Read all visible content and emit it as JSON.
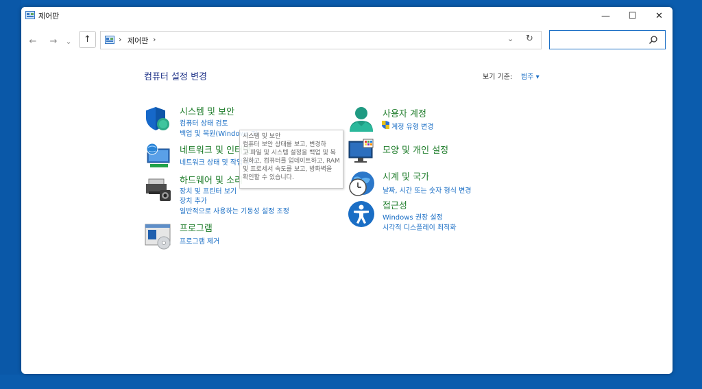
{
  "window": {
    "title": "제어판",
    "minimize": "—",
    "maximize": "☐",
    "close": "✕"
  },
  "nav": {
    "back": "←",
    "forward": "→",
    "recent": "⌄",
    "up": "↑"
  },
  "address": {
    "sep1": "›",
    "crumb": "제어판",
    "sep2": "›",
    "dropdown": "⌄",
    "refresh": "↻"
  },
  "search": {
    "placeholder": ""
  },
  "header": {
    "heading": "컴퓨터 설정 변경",
    "view_by_label": "보기 기준:",
    "view_by_value": "범주 ▾"
  },
  "categories": {
    "system": {
      "title": "시스템 및 보안",
      "links": [
        "컴퓨터 상태 검토",
        "백업 및 복원(Windows 7)"
      ]
    },
    "network": {
      "title": "네트워크 및 인터넷",
      "links": [
        "네트워크 상태 및 작업 보기"
      ]
    },
    "hardware": {
      "title": "하드웨어 및 소리",
      "links": [
        "장치 및 프린터 보기",
        "장치 추가",
        "일반적으로 사용하는 기동성 설정 조정"
      ]
    },
    "programs": {
      "title": "프로그램",
      "links": [
        "프로그램 제거"
      ]
    },
    "users": {
      "title": "사용자 계정",
      "links": [
        "계정 유형 변경"
      ]
    },
    "appearance": {
      "title": "모양 및 개인 설정",
      "links": []
    },
    "clock": {
      "title": "시계 및 국가",
      "links": [
        "날짜, 시간 또는 숫자 형식 변경"
      ]
    },
    "access": {
      "title": "접근성",
      "links": [
        "Windows 권장 설정",
        "시각적 디스플레이 최적화"
      ]
    }
  },
  "tooltip": {
    "lines": [
      "시스템 및 보안",
      "컴퓨터 보안 상태를 보고, 변경하",
      "고 파일 및 시스템 설정을 백업 및 복",
      "원하고, 컴퓨터를 업데이트하고, RAM",
      "및 프로세서 속도를 보고, 방화벽을",
      "확인할 수 있습니다."
    ]
  },
  "colors": {
    "accent": "#1a6ec5",
    "category_title": "#1e7c2a",
    "heading": "#1e3287",
    "desktop": "#0b5cad"
  },
  "icons": [
    "control-panel-icon",
    "shield-icon",
    "network-icon",
    "printer-icon",
    "programs-icon",
    "user-icon",
    "uac-shield-icon",
    "monitor-icon",
    "clock-icon",
    "accessibility-icon",
    "search-icon"
  ]
}
